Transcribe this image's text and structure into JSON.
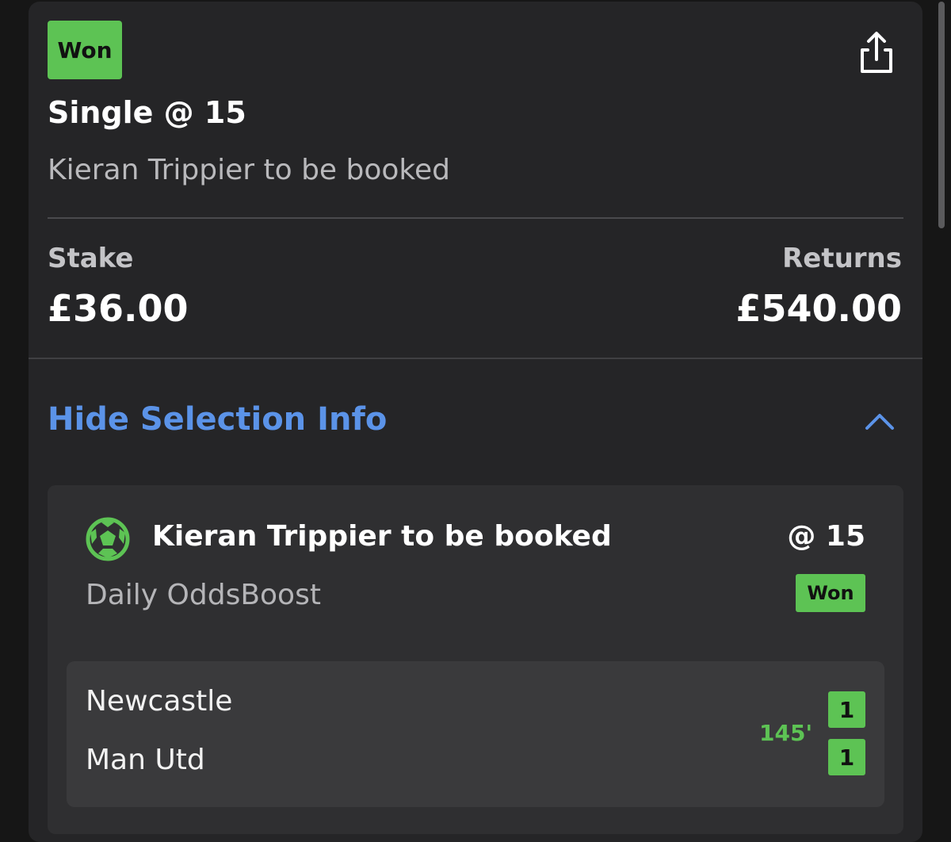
{
  "bet": {
    "status": "Won",
    "title": "Single @ 15",
    "description": "Kieran Trippier to be booked",
    "stake_label": "Stake",
    "stake_value": "£36.00",
    "returns_label": "Returns",
    "returns_value": "£540.00",
    "toggle_label": "Hide Selection Info",
    "share_icon": "share-icon",
    "chevron_icon": "chevron-up-icon"
  },
  "selection": {
    "sport_icon": "football-icon",
    "name": "Kieran Trippier to be booked",
    "odds": "@ 15",
    "market": "Daily OddsBoost",
    "status": "Won"
  },
  "match": {
    "home_team": "Newcastle",
    "away_team": "Man Utd",
    "time": "145'",
    "home_score": "1",
    "away_score": "1"
  },
  "colors": {
    "background": "#161616",
    "card": "#252527",
    "accent_green": "#5dc354",
    "link_blue": "#5b93e8",
    "text_primary": "#ffffff",
    "text_secondary": "#b9b9bc"
  }
}
